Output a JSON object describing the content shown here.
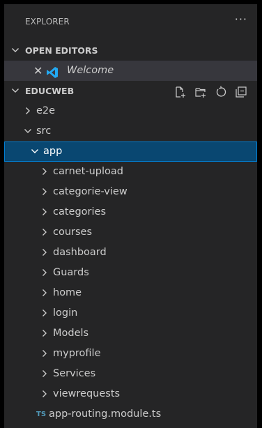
{
  "explorer": {
    "title": "EXPLORER",
    "more": "···"
  },
  "open_editors": {
    "header": "OPEN EDITORS",
    "items": [
      {
        "label": "Welcome"
      }
    ]
  },
  "project": {
    "header": "EDUCWEB",
    "tree": {
      "e2e": "e2e",
      "src": "src",
      "app": "app",
      "folders": [
        "carnet-upload",
        "categorie-view",
        "categories",
        "courses",
        "dashboard",
        "Guards",
        "home",
        "login",
        "Models",
        "myprofile",
        "Services",
        "viewrequests"
      ],
      "file_badge": "TS",
      "file": "app-routing.module.ts"
    }
  },
  "colors": {
    "panel_bg": "#252526",
    "selection_bg": "#094771",
    "selection_border": "#007fd4",
    "ts_badge": "#519aba",
    "vscode_blue": "#23a9f2"
  }
}
